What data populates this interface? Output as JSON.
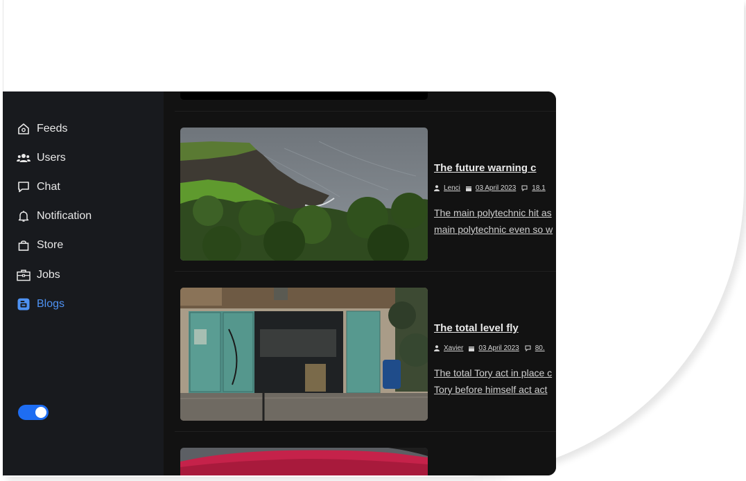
{
  "sidebar": {
    "items": [
      {
        "label": "Feeds",
        "icon": "home-icon"
      },
      {
        "label": "Users",
        "icon": "users-icon"
      },
      {
        "label": "Chat",
        "icon": "chat-icon"
      },
      {
        "label": "Notification",
        "icon": "bell-icon"
      },
      {
        "label": "Store",
        "icon": "shopping-bag-icon"
      },
      {
        "label": "Jobs",
        "icon": "briefcase-icon"
      },
      {
        "label": "Blogs",
        "icon": "blogger-icon"
      }
    ],
    "active": "Blogs",
    "accent_color": "#4e92f3",
    "theme_toggle": {
      "on": true,
      "color": "#1e6df2"
    }
  },
  "posts": [
    {
      "title": "The future warning c",
      "author": "Lenci",
      "date": "03 April 2023",
      "comments": "18.1",
      "excerpt_lines": [
        "The main polytechnic hit as",
        "main polytechnic even so w"
      ]
    },
    {
      "title": "The total level fly",
      "author": "Xavier",
      "date": "03 April 2023",
      "comments": "80.",
      "excerpt_lines": [
        "The total Tory act in place c",
        "Tory before himself act act"
      ]
    }
  ]
}
